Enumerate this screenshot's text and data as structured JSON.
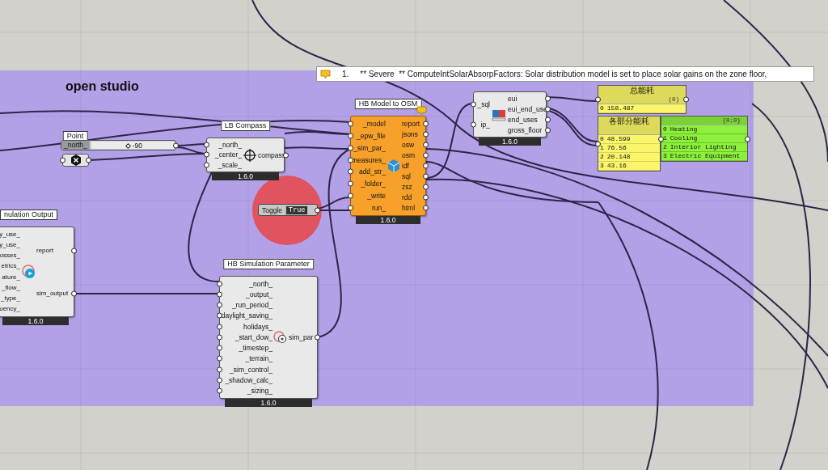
{
  "group": {
    "title": "open studio"
  },
  "warning": {
    "number": "1.",
    "message": "** Severe  ** ComputeIntSolarAbsorpFactors: Solar distribution model is set to place solar gains on the zone floor,"
  },
  "slider": {
    "tag": "Point",
    "label": "_north_",
    "value": "-90",
    "level": 0.42
  },
  "components": [
    {
      "kind": "standard",
      "title": "nulation Output",
      "inputs": [
        "y_use_",
        "y_use_",
        "osses_",
        "etrics_",
        "ature_",
        "_flow_",
        "_type_",
        "uency_"
      ],
      "outputs": [
        "report",
        "sim_output"
      ],
      "version": "1.6.0"
    },
    {
      "kind": "standard",
      "title": "LB Compass",
      "inputs": [
        "_north_",
        "_center_",
        "_scale_"
      ],
      "outputs": [
        "compass"
      ],
      "version": "1.6.0"
    },
    {
      "kind": "orange",
      "title": "HB Model to OSM",
      "inputs": [
        "_model",
        "_epw_file",
        "_sim_par_",
        "measures_",
        "add_str_",
        "_folder_",
        "_write",
        "run_"
      ],
      "outputs": [
        "report",
        "jsons",
        "osw",
        "osm",
        "idf",
        "sql",
        "zsz",
        "rdd",
        "html"
      ],
      "version": "1.6.0",
      "has_warning": true
    },
    {
      "kind": "standard",
      "inputs": [
        "_sql",
        "ip_"
      ],
      "outputs": [
        "eui",
        "eui_end_use",
        "end_uses",
        "gross_floor"
      ],
      "version": "1.6.0"
    },
    {
      "kind": "standard",
      "title": "HB Simulation Parameter",
      "inputs": [
        "_north_",
        "_output_",
        "_run_period_",
        "daylight_saving_",
        "holidays_",
        "_start_dow_",
        "_timestep_",
        "_terrain_",
        "_sim_control_",
        "_shadow_calc_",
        "_sizing_"
      ],
      "outputs": [
        "sim_par"
      ],
      "version": "1.6.0"
    }
  ],
  "toggle": {
    "label": "Toggle",
    "value": "True"
  },
  "panels": [
    {
      "kind": "yellow",
      "title": "总能耗",
      "path": "(0)",
      "rows": [
        {
          "index": "0",
          "value": "158.487"
        }
      ]
    },
    {
      "kind": "yellow",
      "title": "各部分能耗",
      "rows": [
        {
          "index": "0",
          "value": "48.599"
        },
        {
          "index": "1",
          "value": "76.56"
        },
        {
          "index": "2",
          "value": "20.148"
        },
        {
          "index": "3",
          "value": "43.16"
        }
      ]
    },
    {
      "kind": "green",
      "path": "{0;0}",
      "rows": [
        {
          "index": "0",
          "value": "Heating"
        },
        {
          "index": "1",
          "value": "Cooling"
        },
        {
          "index": "2",
          "value": "Interior Lighting"
        },
        {
          "index": "3",
          "value": "Electric Equipment"
        }
      ]
    }
  ]
}
